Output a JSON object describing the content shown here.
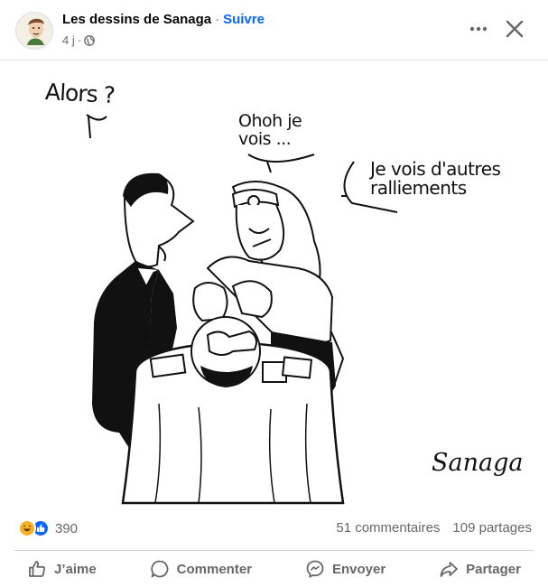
{
  "post": {
    "page_name": "Les dessins de Sanaga",
    "separator": "·",
    "follow_label": "Suivre",
    "time": "4 j",
    "meta_dot": "·"
  },
  "cartoon": {
    "bubble_left": "Alors ?",
    "bubble_middle": "Ohoh je vois ...",
    "bubble_right": "Je vois d'autres ralliements",
    "signature": "Sanaga"
  },
  "stats": {
    "reaction_count": "390",
    "comments": "51 commentaires",
    "shares": "109 partages"
  },
  "actions": {
    "like": "J’aime",
    "comment": "Commenter",
    "send": "Envoyer",
    "share": "Partager"
  },
  "icons": [
    "globe-icon",
    "more-options-icon",
    "close-icon",
    "haha-reaction-icon",
    "like-reaction-icon",
    "thumbs-up-icon",
    "comment-icon",
    "messenger-icon",
    "share-icon"
  ],
  "colors": {
    "accent": "#0866ff",
    "secondary_text": "#65676b",
    "haha": "#f7b125"
  }
}
